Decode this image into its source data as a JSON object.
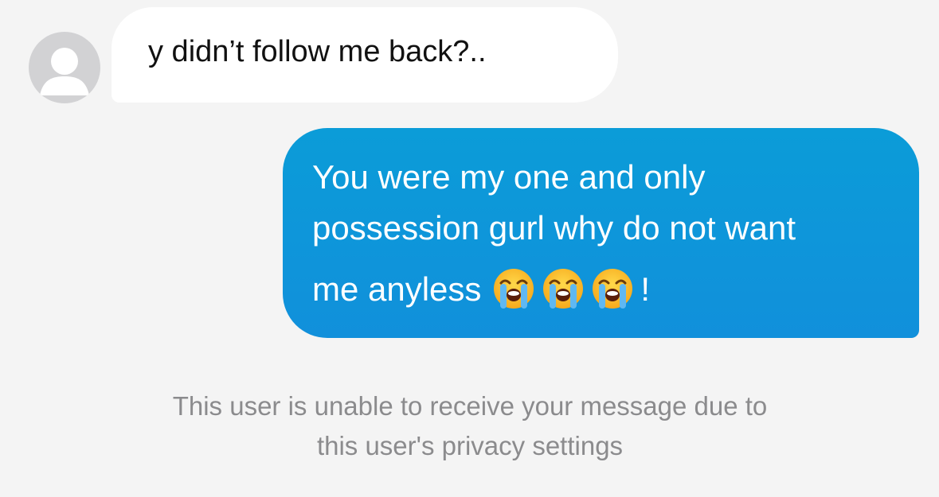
{
  "conversation": {
    "incoming": {
      "avatar_icon": "default-user-icon",
      "text": "y didn’t follow me back?.."
    },
    "outgoing": {
      "line1": "You were my one and only",
      "line2": "possession gurl why do not want",
      "line3": "me anyless",
      "emojis": [
        "loudly-crying-face",
        "loudly-crying-face",
        "loudly-crying-face"
      ],
      "suffix": "!",
      "bubble_color": "#0b9cd8"
    },
    "notice": {
      "line1": "This user is unable to receive your message due to",
      "line2": "this user's privacy settings"
    }
  },
  "colors": {
    "background": "#f4f4f4",
    "incoming_bubble": "#ffffff",
    "notice_text": "#8b8b8d"
  }
}
